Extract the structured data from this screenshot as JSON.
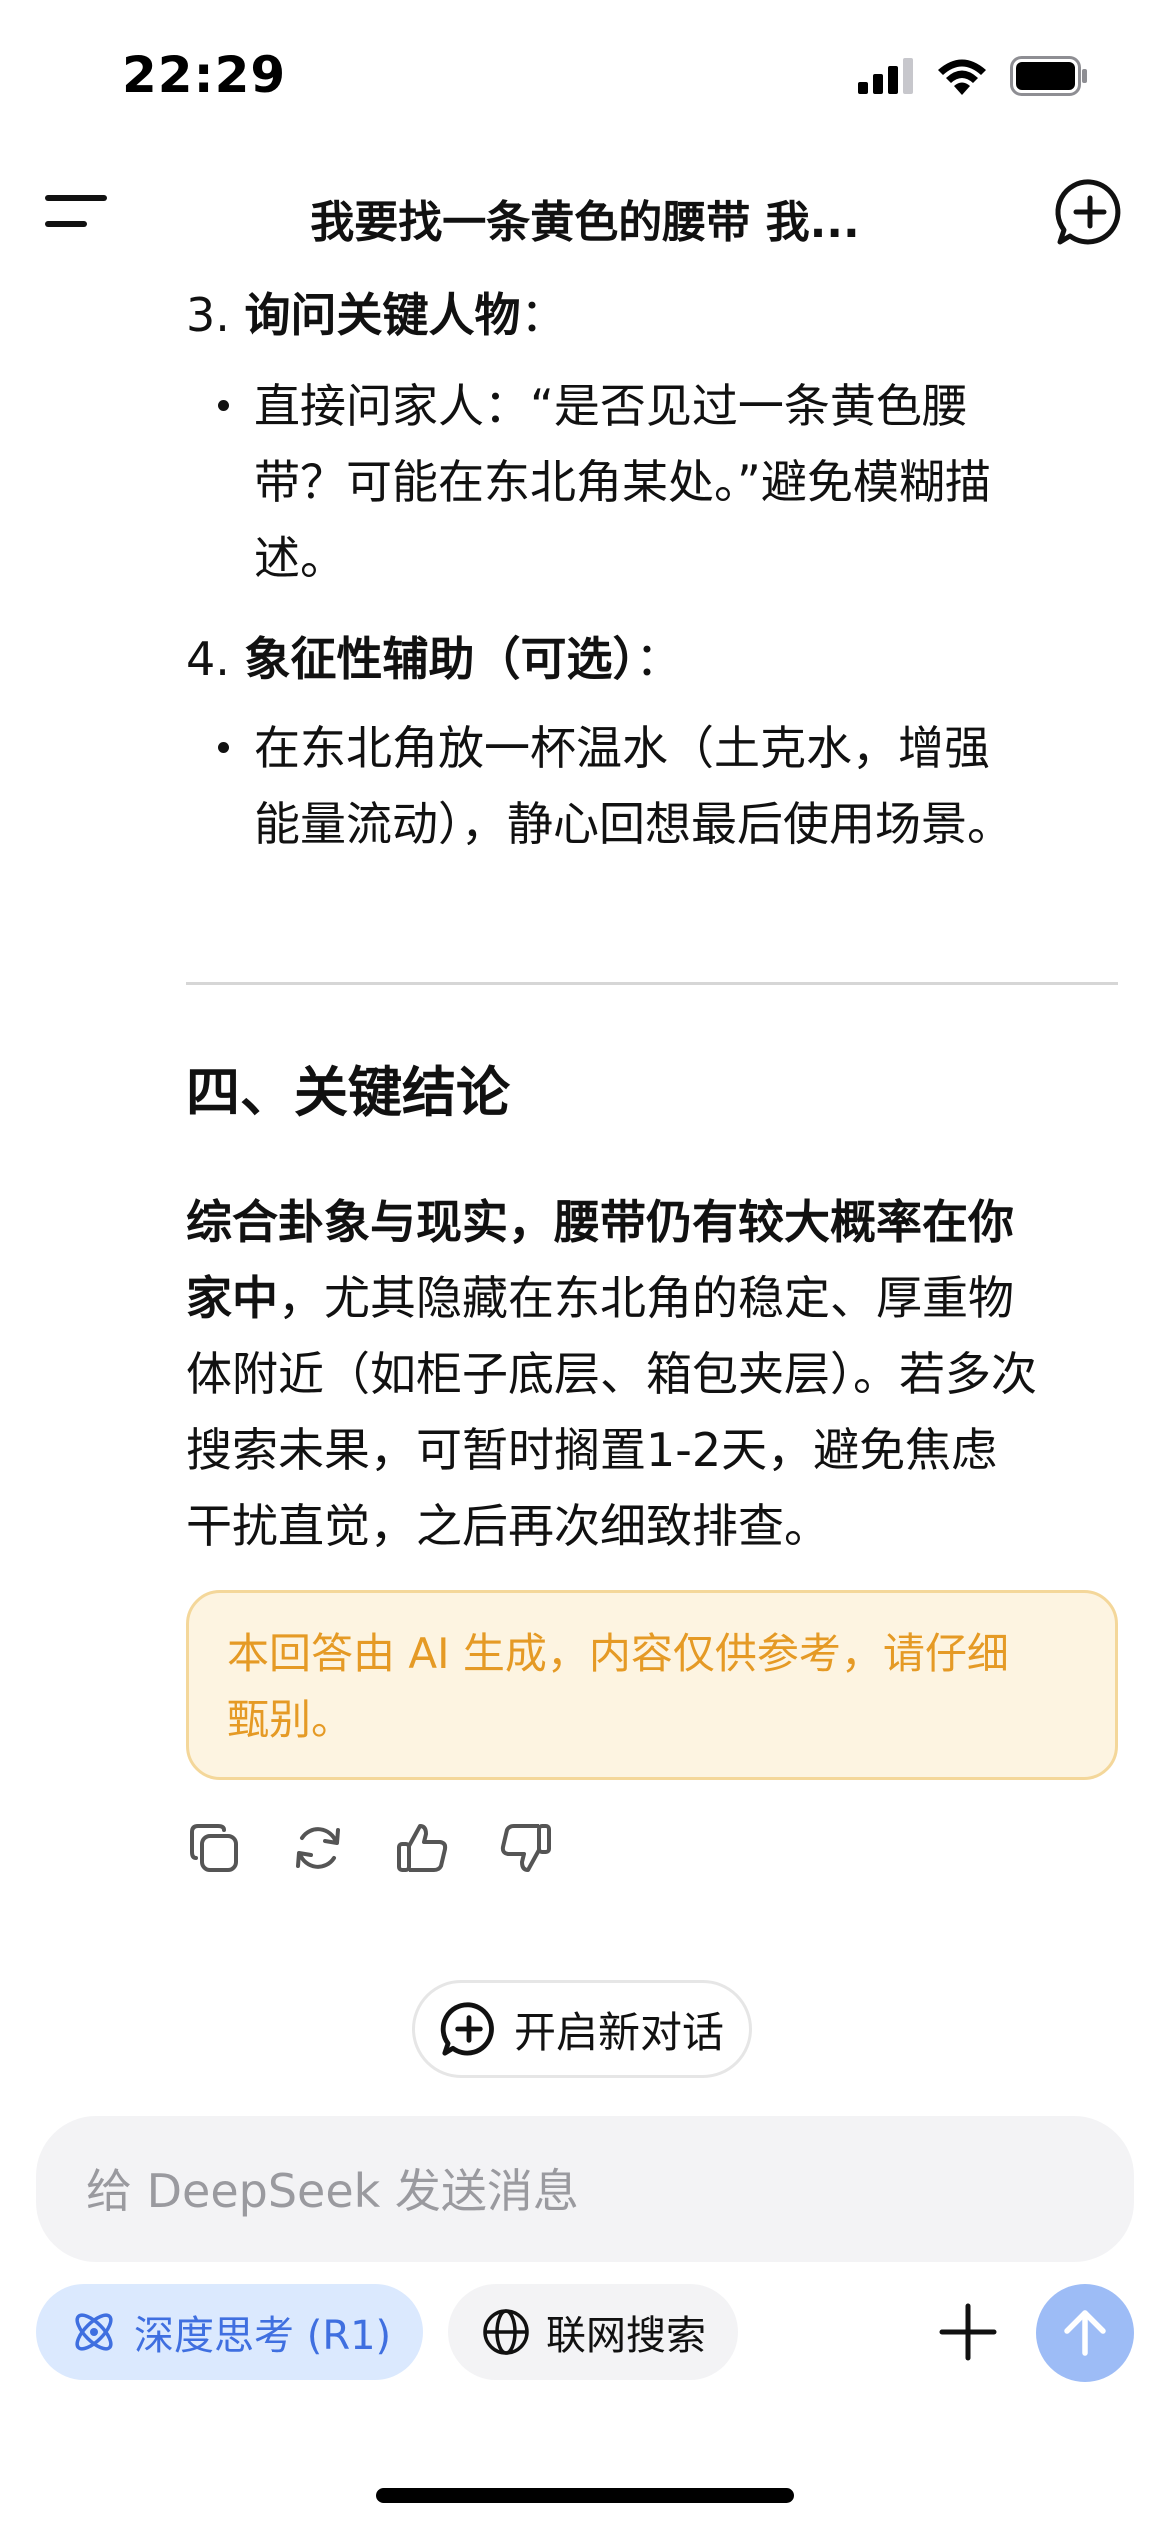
{
  "status_bar": {
    "time": "22:29",
    "icons": [
      "cellular-signal-icon",
      "wifi-icon",
      "battery-icon"
    ]
  },
  "nav": {
    "title": "我要找一条黄色的腰带 我...",
    "menu_icon": "menu-icon",
    "new_chat_icon": "new-chat-icon"
  },
  "content": {
    "items": [
      {
        "number": "3.",
        "heading": "询问关键人物",
        "suffix": "：",
        "bullet_lines": [
          "直接问家人：“是否见过一条黄色腰",
          "带？可能在东北角某处。”避免模糊描",
          "述。"
        ]
      },
      {
        "number": "4.",
        "heading": "象征性辅助（可选）",
        "suffix": "：",
        "bullet_lines": [
          "在东北角放一杯温水（土克水，增强",
          "能量流动），静心回想最后使用场景。"
        ]
      }
    ],
    "section_heading": "四、关键结论",
    "conclusion": {
      "bold_lines": [
        "综合卦象与现实，腰带仍有较大概率在你",
        "家中"
      ],
      "normal_lines": [
        "，尤其隐藏在东北角的稳定、厚重物",
        "体附近（如柜子底层、箱包夹层）。若多次",
        "搜索未果，可暂时搁置1-2天，避免焦虑",
        "干扰直觉，之后再次细致排查。"
      ]
    },
    "disclaimer_lines": [
      "本回答由 AI 生成，内容仅供参考，请仔细",
      "甄别。"
    ]
  },
  "actions": [
    {
      "name": "copy-icon"
    },
    {
      "name": "regenerate-icon"
    },
    {
      "name": "thumbs-up-icon"
    },
    {
      "name": "thumbs-down-icon"
    }
  ],
  "new_dialog": {
    "label": "开启新对话"
  },
  "composer": {
    "placeholder": "给 DeepSeek 发送消息",
    "value": ""
  },
  "toolbar": {
    "deep_think_label": "深度思考 (R1)",
    "web_search_label": "联网搜索"
  },
  "colors": {
    "accent_blue": "#3f6fe0",
    "send_button": "#9dbcf6",
    "disclaimer_text": "#e59a25",
    "disclaimer_bg": "#fdf4e1",
    "disclaimer_border": "#f4d79a"
  }
}
